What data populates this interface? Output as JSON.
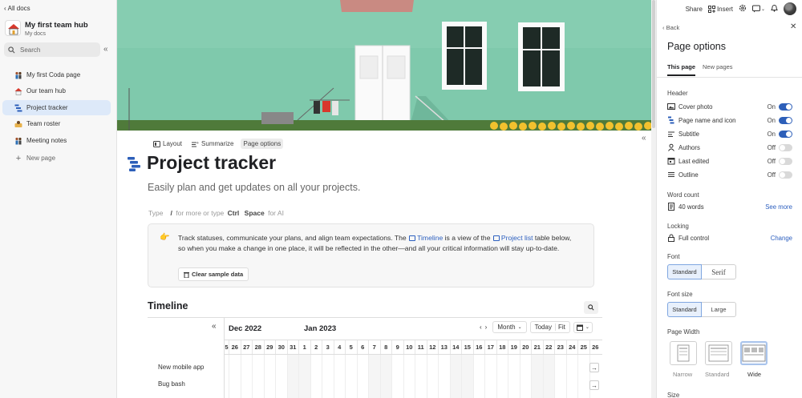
{
  "sidebar": {
    "all_docs": "All docs",
    "hub_title": "My first team hub",
    "hub_subtitle": "My docs",
    "search_placeholder": "Search",
    "items": [
      {
        "label": "My first Coda page"
      },
      {
        "label": "Our team hub"
      },
      {
        "label": "Project tracker"
      },
      {
        "label": "Team roster"
      },
      {
        "label": "Meeting notes"
      }
    ],
    "new_page": "New page"
  },
  "topbar": {
    "share": "Share",
    "insert": "Insert"
  },
  "page": {
    "toolbar": {
      "layout": "Layout",
      "summarize": "Summarize",
      "page_options": "Page options"
    },
    "title": "Project tracker",
    "subtitle": "Easily plan and get updates on all your projects.",
    "hint": {
      "type": "Type",
      "slash": "/",
      "more": "for more or type",
      "ctrl": "Ctrl",
      "space": "Space",
      "for_ai": "for AI"
    },
    "callout": {
      "emoji": "👉",
      "text_1": "Track statuses, communicate your plans, and align team expectations. The",
      "link_1": "Timeline",
      "text_2": "is a view of the",
      "link_2": "Project list",
      "text_3": "table below, so when you make a change in one place, it will be reflected in the other—and all your critical information will stay up-to-date.",
      "clear_button": "Clear sample data"
    },
    "timeline": {
      "heading": "Timeline",
      "month_1": "Dec 2022",
      "month_2": "Jan 2023",
      "controls": {
        "period": "Month",
        "today": "Today",
        "fit": "Fit"
      },
      "days": [
        "5",
        "26",
        "27",
        "28",
        "29",
        "30",
        "31",
        "1",
        "2",
        "3",
        "4",
        "5",
        "6",
        "7",
        "8",
        "9",
        "10",
        "11",
        "12",
        "13",
        "14",
        "15",
        "16",
        "17",
        "18",
        "19",
        "20",
        "21",
        "22",
        "23",
        "24",
        "25",
        "26"
      ],
      "rows": [
        {
          "label": "New mobile app"
        },
        {
          "label": "Bug bash"
        }
      ]
    }
  },
  "panel": {
    "back": "Back",
    "title": "Page options",
    "tabs": [
      "This page",
      "New pages"
    ],
    "header_section": "Header",
    "header_options": [
      {
        "label": "Cover photo",
        "state": "On",
        "on": true
      },
      {
        "label": "Page name and icon",
        "state": "On",
        "on": true
      },
      {
        "label": "Subtitle",
        "state": "On",
        "on": true
      },
      {
        "label": "Authors",
        "state": "Off",
        "on": false
      },
      {
        "label": "Last edited",
        "state": "Off",
        "on": false
      },
      {
        "label": "Outline",
        "state": "Off",
        "on": false
      }
    ],
    "word_count_section": "Word count",
    "word_count": "40 words",
    "see_more": "See more",
    "locking_section": "Locking",
    "locking_value": "Full control",
    "locking_change": "Change",
    "font_section": "Font",
    "font_options": [
      "Standard",
      "Serif"
    ],
    "font_size_section": "Font size",
    "font_size_options": [
      "Standard",
      "Large"
    ],
    "page_width_section": "Page Width",
    "page_width_options": [
      "Narrow",
      "Standard",
      "Wide"
    ],
    "size_section": "Size"
  },
  "colors": {
    "accent": "#2d5fb9",
    "link": "#2c5fbf",
    "active_nav": "#dde9f9",
    "cover_wall": "#7fc9ac"
  }
}
